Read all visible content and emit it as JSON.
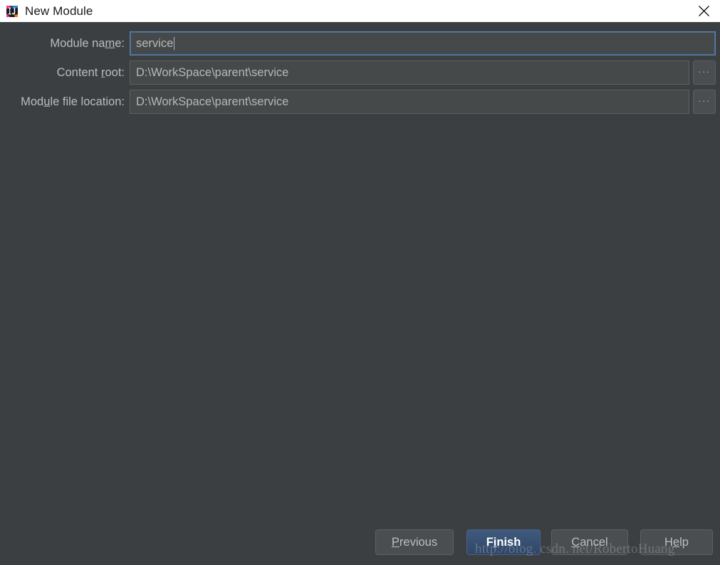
{
  "window": {
    "title": "New Module",
    "icon": "intellij-idea-icon",
    "close_label": "✕",
    "titlebar_bg": "#ffffff",
    "body_bg": "#3c3f41"
  },
  "form": {
    "rows": [
      {
        "label_pre": "Module na",
        "label_mnemonic": "m",
        "label_post": "e:",
        "value": "service",
        "focused": true,
        "has_browse": false
      },
      {
        "label_pre": "Content ",
        "label_mnemonic": "r",
        "label_post": "oot:",
        "value": "D:\\WorkSpace\\parent\\service",
        "focused": false,
        "has_browse": true,
        "browse_label": "···"
      },
      {
        "label_pre": "Mod",
        "label_mnemonic": "u",
        "label_post": "le file location:",
        "value": "D:\\WorkSpace\\parent\\service",
        "focused": false,
        "has_browse": true,
        "browse_label": "···"
      }
    ]
  },
  "footer": {
    "previous": {
      "pre": "",
      "mnemonic": "P",
      "post": "revious"
    },
    "finish": {
      "pre": "F",
      "mnemonic": "i",
      "post": "nish"
    },
    "cancel": {
      "pre": "",
      "mnemonic": "C",
      "post": "ancel"
    },
    "help": {
      "pre": "H",
      "mnemonic": "e",
      "post": "lp"
    }
  },
  "watermark": {
    "text": "http://blog. csdn. net/RobertoHuang"
  },
  "colors": {
    "accent_focus_border": "#5781b0",
    "default_button_bg": "#3f5a7d",
    "field_bg": "#45494a",
    "text": "#bbbbbb"
  }
}
